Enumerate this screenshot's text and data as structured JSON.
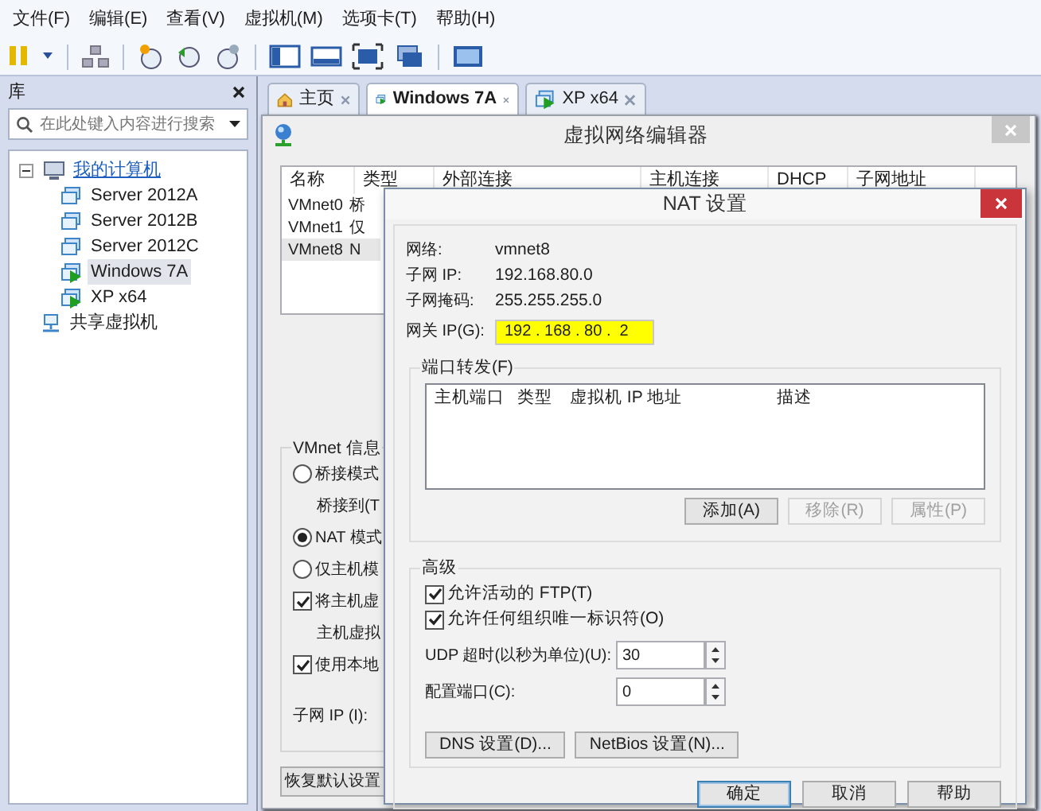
{
  "menu_bar": [
    "文件(F)",
    "编辑(E)",
    "查看(V)",
    "虚拟机(M)",
    "选项卡(T)",
    "帮助(H)"
  ],
  "library": {
    "title": "库",
    "search": {
      "placeholder": "在此处键入内容进行搜索"
    },
    "tree": [
      {
        "label": "我的计算机",
        "kind": "computer",
        "expanded": true,
        "selected": false,
        "children": [
          {
            "label": "Server 2012A",
            "kind": "vm",
            "running": false,
            "selected": false
          },
          {
            "label": "Server 2012B",
            "kind": "vm",
            "running": false,
            "selected": false
          },
          {
            "label": "Server 2012C",
            "kind": "vm",
            "running": false,
            "selected": false
          },
          {
            "label": "Windows 7A",
            "kind": "vm",
            "running": true,
            "selected": true
          },
          {
            "label": "XP x64",
            "kind": "vm",
            "running": true,
            "selected": false
          }
        ]
      },
      {
        "label": "共享虚拟机",
        "kind": "shared",
        "selected": false
      }
    ]
  },
  "tabs": [
    {
      "label": "主页",
      "kind": "home",
      "selected": false
    },
    {
      "label": "Windows 7A",
      "kind": "vm",
      "selected": true
    },
    {
      "label": "XP x64",
      "kind": "vm",
      "selected": false
    }
  ],
  "network_editor": {
    "title": "虚拟网络编辑器",
    "table": {
      "columns": [
        "名称",
        "类型",
        "外部连接",
        "主机连接",
        "DHCP",
        "子网地址"
      ],
      "rows": [
        {
          "cells": [
            "VMnet0",
            "桥"
          ],
          "selected": false
        },
        {
          "cells": [
            "VMnet1",
            "仅"
          ],
          "selected": false
        },
        {
          "cells": [
            "VMnet8",
            "N"
          ],
          "selected": true
        }
      ]
    },
    "vmnet_info": {
      "title": "VMnet 信息",
      "items": [
        {
          "kind": "radio",
          "label": "桥接模式",
          "selected": false
        },
        {
          "kind": "text",
          "label": "桥接到(T"
        },
        {
          "kind": "radio",
          "label": "NAT 模式",
          "selected": true
        },
        {
          "kind": "radio",
          "label": "仅主机模",
          "selected": false
        },
        {
          "kind": "checkbox",
          "label": "将主机虚",
          "checked": true
        },
        {
          "kind": "text",
          "label": "主机虚拟"
        },
        {
          "kind": "checkbox",
          "label": "使用本地",
          "checked": true
        },
        {
          "kind": "text",
          "label": "子网 IP (I):"
        }
      ]
    },
    "restore_button": "恢复默认设置"
  },
  "nat_dialog": {
    "title": "NAT 设置",
    "info": [
      {
        "label": "网络:",
        "value": "vmnet8"
      },
      {
        "label": "子网 IP:",
        "value": "192.168.80.0"
      },
      {
        "label": "子网掩码:",
        "value": "255.255.255.0"
      }
    ],
    "gateway": {
      "label": "网关 IP(G):",
      "value": "192 . 168 . 80 .  2"
    },
    "port_forwarding": {
      "title": "端口转发(F)",
      "columns": [
        "主机端口",
        "类型",
        "虚拟机 IP 地址",
        "描述"
      ],
      "buttons": [
        {
          "label": "添加(A)",
          "disabled": false
        },
        {
          "label": "移除(R)",
          "disabled": true
        },
        {
          "label": "属性(P)",
          "disabled": true
        }
      ]
    },
    "advanced": {
      "title": "高级",
      "checkboxes": [
        {
          "label": "允许活动的 FTP(T)",
          "checked": true
        },
        {
          "label": "允许任何组织唯一标识符(O)",
          "checked": true
        }
      ],
      "spinners": [
        {
          "label": "UDP 超时(以秒为单位)(U):",
          "value": "30"
        },
        {
          "label": "配置端口(C):",
          "value": "0"
        }
      ],
      "buttons": [
        "DNS 设置(D)...",
        "NetBios 设置(N)..."
      ]
    },
    "buttons": [
      {
        "label": "确定",
        "default": true
      },
      {
        "label": "取消",
        "default": false
      },
      {
        "label": "帮助",
        "default": false
      }
    ]
  }
}
